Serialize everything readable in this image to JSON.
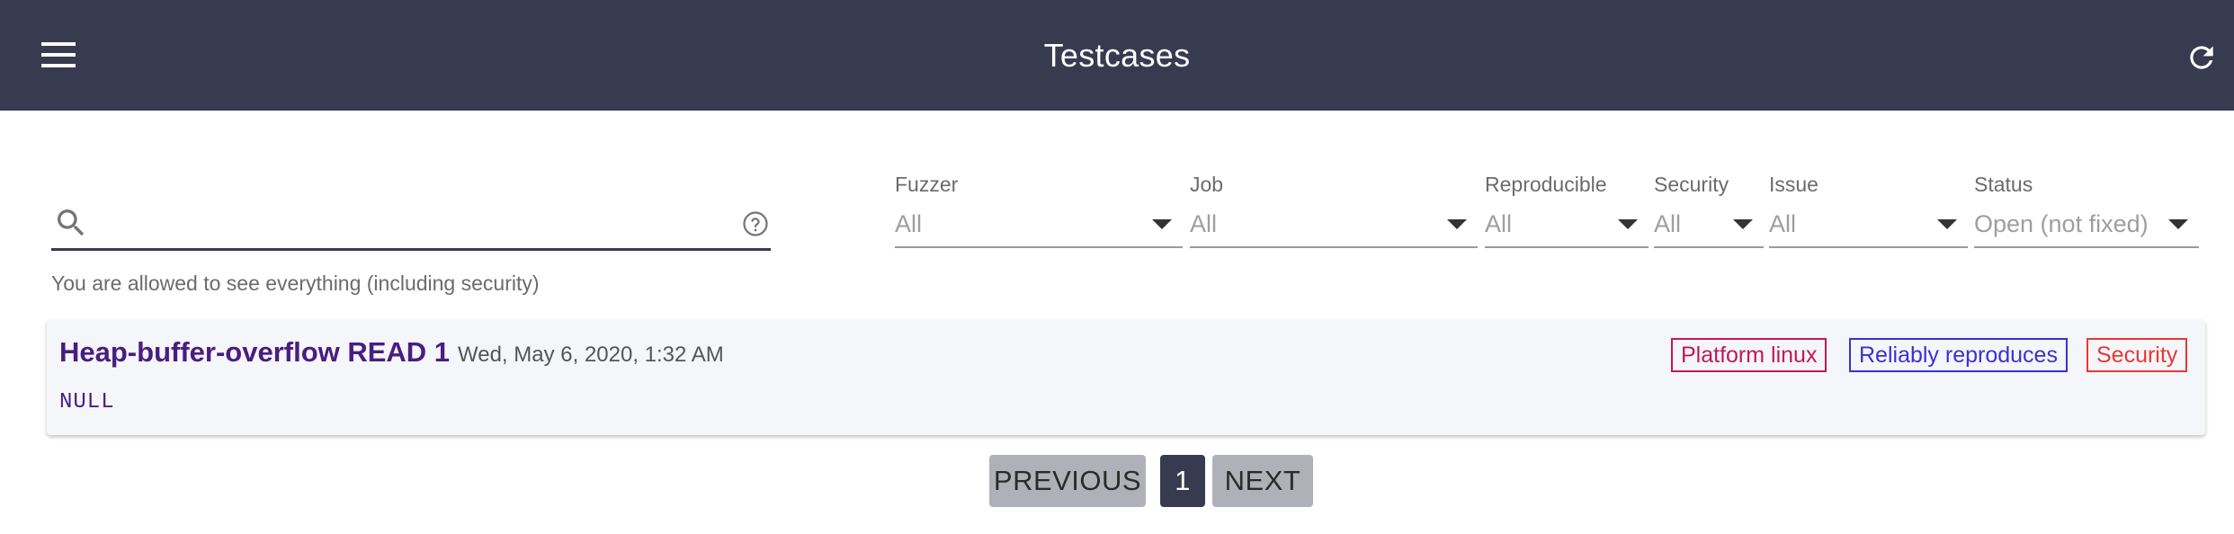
{
  "header": {
    "title": "Testcases",
    "menu_icon": "menu-icon",
    "refresh_icon": "refresh-icon",
    "background": "#383a4f"
  },
  "search": {
    "value": "",
    "placeholder": "",
    "icon": "search-icon",
    "help_icon": "help-icon",
    "permission_note": "You are allowed to see everything (including security)"
  },
  "filters": [
    {
      "label": "Fuzzer",
      "value": "All"
    },
    {
      "label": "Job",
      "value": "All"
    },
    {
      "label": "Reproducible",
      "value": "All"
    },
    {
      "label": "Security",
      "value": "All"
    },
    {
      "label": "Issue",
      "value": "All"
    },
    {
      "label": "Status",
      "value": "Open (not fixed)"
    }
  ],
  "testcases": [
    {
      "crash_type": "Heap-buffer-overflow READ 1",
      "timestamp": "Wed, May 6, 2020, 1:32 AM",
      "crash_state": "NULL",
      "badges": [
        {
          "label": "Platform linux",
          "color": "#c2185b"
        },
        {
          "label": "Reliably reproduces",
          "color": "#3f2fcf"
        },
        {
          "label": "Security",
          "color": "#e53935"
        }
      ]
    }
  ],
  "pagination": {
    "previous_label": "PREVIOUS",
    "current_page": "1",
    "next_label": "NEXT"
  }
}
